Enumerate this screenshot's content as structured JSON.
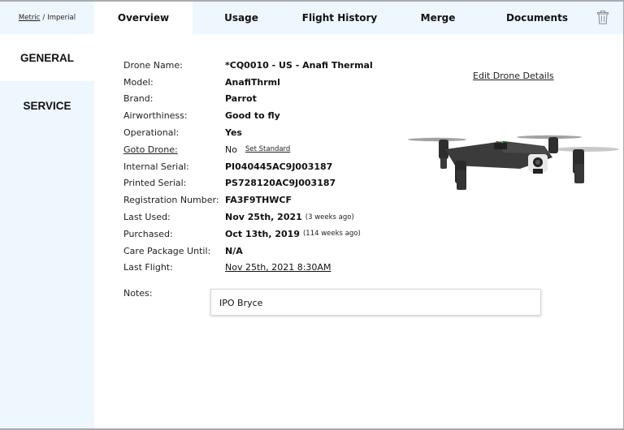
{
  "topbar": {
    "units": {
      "metric": "Metric",
      "separator": "/",
      "imperial": "Imperial",
      "selected": "Metric"
    },
    "tabs": [
      {
        "label": "Overview",
        "active": true
      },
      {
        "label": "Usage",
        "active": false
      },
      {
        "label": "Flight History",
        "active": false
      },
      {
        "label": "Merge",
        "active": false
      },
      {
        "label": "Documents",
        "active": false
      }
    ],
    "delete_icon": "trash-icon"
  },
  "sidebar": {
    "items": [
      {
        "label": "GENERAL",
        "active": true
      },
      {
        "label": "SERVICE",
        "active": false
      }
    ]
  },
  "details": {
    "drone_name": {
      "label": "Drone Name:",
      "value": "*CQ0010 - US - Anafi Thermal"
    },
    "model": {
      "label": "Model:",
      "value": "AnafiThrml"
    },
    "brand": {
      "label": "Brand:",
      "value": "Parrot"
    },
    "airworthiness": {
      "label": "Airworthiness:",
      "value": "Good to fly"
    },
    "operational": {
      "label": "Operational:",
      "value": "Yes"
    },
    "goto_drone": {
      "label": "Goto Drone:",
      "value": "No",
      "action": "Set Standard"
    },
    "internal_serial": {
      "label": "Internal Serial:",
      "value": "PI040445AC9J003187"
    },
    "printed_serial": {
      "label": "Printed Serial:",
      "value": "PS728120AC9J003187"
    },
    "registration_number": {
      "label": "Registration Number:",
      "value": "FA3F9THWCF"
    },
    "last_used": {
      "label": "Last Used:",
      "value": "Nov 25th, 2021",
      "relative": "(3 weeks ago)"
    },
    "purchased": {
      "label": "Purchased:",
      "value": "Oct 13th, 2019",
      "relative": "(114 weeks ago)"
    },
    "care_package_until": {
      "label": "Care Package Until:",
      "value": "N/A"
    },
    "last_flight": {
      "label": "Last Flight:",
      "value": "Nov 25th, 2021 8:30AM"
    }
  },
  "edit_link": "Edit Drone Details",
  "drone_image": "drone-photo",
  "notes": {
    "label": "Notes:",
    "value": "IPO Bryce"
  },
  "colors": {
    "nav_background": "#eef6fe",
    "active_background": "#ffffff",
    "border": "#a9acb1"
  }
}
